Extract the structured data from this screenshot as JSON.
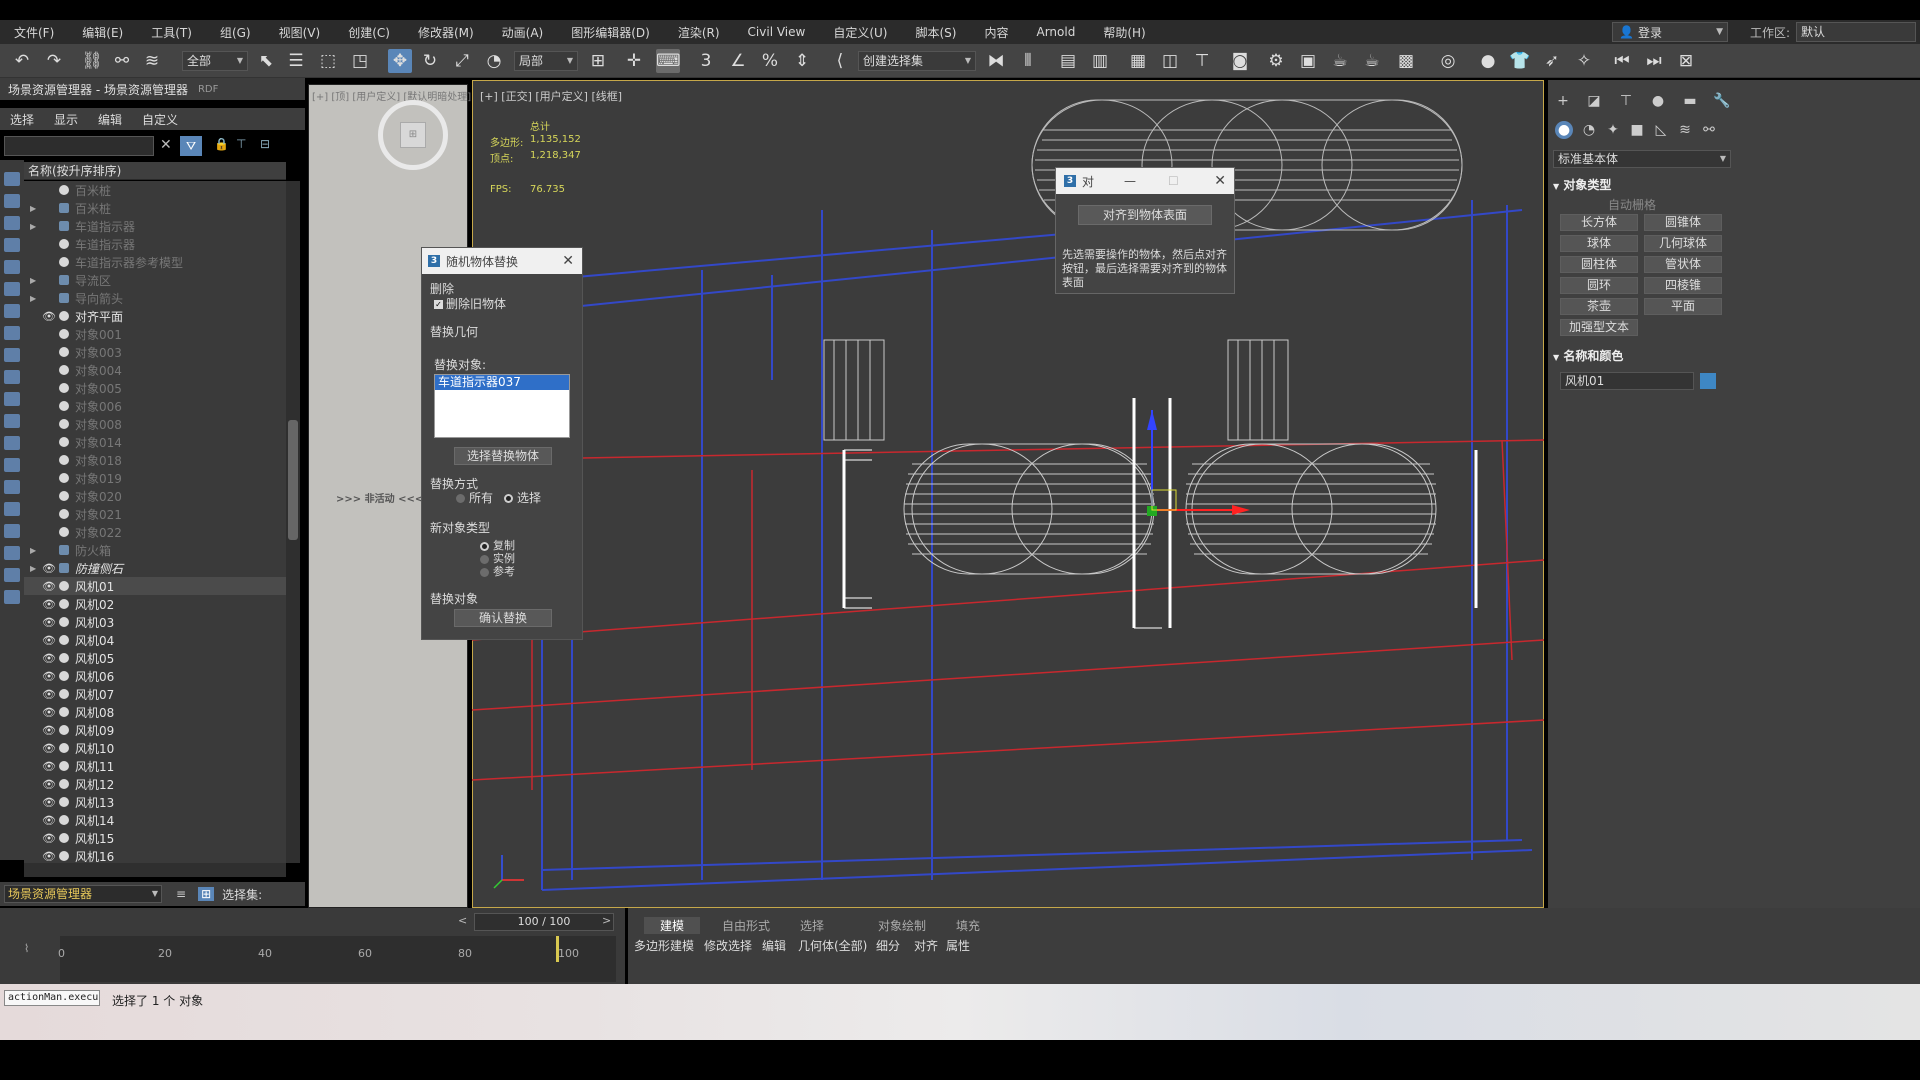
{
  "menu": [
    "文件(F)",
    "编辑(E)",
    "工具(T)",
    "组(G)",
    "视图(V)",
    "创建(C)",
    "修改器(M)",
    "动画(A)",
    "图形编辑器(D)",
    "渲染(R)",
    "Civil View",
    "自定义(U)",
    "脚本(S)",
    "内容",
    "Arnold",
    "帮助(H)"
  ],
  "login": "登录",
  "workspace": {
    "label": "工作区:",
    "value": "默认"
  },
  "toolbar": {
    "filter": "全部",
    "coord": "局部",
    "selset": "创建选择集"
  },
  "scene_explorer": {
    "title": "场景资源管理器 - 场景资源管理器",
    "badge": "RDF",
    "menus": [
      "选择",
      "显示",
      "编辑",
      "自定义"
    ],
    "header": "名称(按升序排序)",
    "items": [
      {
        "label": "百米桩",
        "visible": false,
        "expand": false,
        "group": false
      },
      {
        "label": "百米桩",
        "visible": false,
        "expand": true,
        "group": true
      },
      {
        "label": "车道指示器",
        "visible": false,
        "expand": true,
        "group": true
      },
      {
        "label": "车道指示器",
        "visible": false,
        "expand": false,
        "group": false
      },
      {
        "label": "车道指示器参考模型",
        "visible": false,
        "expand": false,
        "group": false
      },
      {
        "label": "导流区",
        "visible": false,
        "expand": true,
        "group": true
      },
      {
        "label": "导向箭头",
        "visible": false,
        "expand": true,
        "group": true
      },
      {
        "label": "对齐平面",
        "visible": true,
        "expand": false,
        "group": false
      },
      {
        "label": "对象001",
        "visible": false,
        "expand": false,
        "group": false
      },
      {
        "label": "对象003",
        "visible": false,
        "expand": false,
        "group": false
      },
      {
        "label": "对象004",
        "visible": false,
        "expand": false,
        "group": false
      },
      {
        "label": "对象005",
        "visible": false,
        "expand": false,
        "group": false
      },
      {
        "label": "对象006",
        "visible": false,
        "expand": false,
        "group": false
      },
      {
        "label": "对象008",
        "visible": false,
        "expand": false,
        "group": false
      },
      {
        "label": "对象014",
        "visible": false,
        "expand": false,
        "group": false
      },
      {
        "label": "对象018",
        "visible": false,
        "expand": false,
        "group": false
      },
      {
        "label": "对象019",
        "visible": false,
        "expand": false,
        "group": false
      },
      {
        "label": "对象020",
        "visible": false,
        "expand": false,
        "group": false
      },
      {
        "label": "对象021",
        "visible": false,
        "expand": false,
        "group": false
      },
      {
        "label": "对象022",
        "visible": false,
        "expand": false,
        "group": false
      },
      {
        "label": "防火箱",
        "visible": false,
        "expand": true,
        "group": true
      },
      {
        "label": "防撞侧石",
        "visible": true,
        "expand": true,
        "group": true,
        "italic": true
      },
      {
        "label": "风机01",
        "visible": true,
        "expand": false,
        "group": false,
        "selected": true
      },
      {
        "label": "风机02",
        "visible": true,
        "expand": false,
        "group": false
      },
      {
        "label": "风机03",
        "visible": true,
        "expand": false,
        "group": false
      },
      {
        "label": "风机04",
        "visible": true,
        "expand": false,
        "group": false
      },
      {
        "label": "风机05",
        "visible": true,
        "expand": false,
        "group": false
      },
      {
        "label": "风机06",
        "visible": true,
        "expand": false,
        "group": false
      },
      {
        "label": "风机07",
        "visible": true,
        "expand": false,
        "group": false
      },
      {
        "label": "风机08",
        "visible": true,
        "expand": false,
        "group": false
      },
      {
        "label": "风机09",
        "visible": true,
        "expand": false,
        "group": false
      },
      {
        "label": "风机10",
        "visible": true,
        "expand": false,
        "group": false
      },
      {
        "label": "风机11",
        "visible": true,
        "expand": false,
        "group": false
      },
      {
        "label": "风机12",
        "visible": true,
        "expand": false,
        "group": false
      },
      {
        "label": "风机13",
        "visible": true,
        "expand": false,
        "group": false
      },
      {
        "label": "风机14",
        "visible": true,
        "expand": false,
        "group": false
      },
      {
        "label": "风机15",
        "visible": true,
        "expand": false,
        "group": false
      },
      {
        "label": "风机16",
        "visible": true,
        "expand": false,
        "group": false
      }
    ],
    "footer_select": "场景资源管理器",
    "footer_selset": "选择集:"
  },
  "viewport_left": {
    "label": "[+] [顶] [用户定义] [默认明暗处理]",
    "inactive": ">>> 非活动 <<<"
  },
  "viewport_main": {
    "label": "[+] [正交] [用户定义] [线框]",
    "stats": {
      "total_label": "总计",
      "poly_label": "多边形:",
      "poly_value": "1,135,152",
      "vert_label": "顶点:",
      "vert_value": "1,218,347",
      "fps_label": "FPS:",
      "fps_value": "76.735"
    }
  },
  "dialog_replace": {
    "title": "随机物体替换",
    "delete_section": "删除",
    "delete_old": "删除旧物体",
    "geometry_section": "替换几何",
    "target_label": "替换对象:",
    "target_item": "车道指示器037",
    "pick_button": "选择替换物体",
    "mode_section": "替换方式",
    "mode_all": "所有",
    "mode_selected": "选择",
    "newtype_section": "新对象类型",
    "type_copy": "复制",
    "type_instance": "实例",
    "type_reference": "参考",
    "replace_section": "替换对象",
    "confirm_button": "确认替换"
  },
  "dialog_align": {
    "title": "对",
    "button": "对齐到物体表面",
    "description": "先选需要操作的物体，然后点对齐按钮，最后选择需要对齐到的物体表面"
  },
  "command_panel": {
    "dropdown": "标准基本体",
    "object_type_title": "对象类型",
    "autogrid": "自动栅格",
    "objects": [
      "长方体",
      "圆锥体",
      "球体",
      "几何球体",
      "圆柱体",
      "管状体",
      "圆环",
      "四棱锥",
      "茶壶",
      "平面",
      "加强型文本"
    ],
    "name_color_title": "名称和颜色",
    "name_value": "风机01",
    "color": "#3e87c4"
  },
  "timeline": {
    "frame": "100 / 100",
    "ticks": [
      "0",
      "20",
      "40",
      "60",
      "80",
      "100"
    ]
  },
  "ribbon": {
    "tabs": [
      "建模",
      "自由形式",
      "选择",
      "对象绘制",
      "填充"
    ],
    "subtabs": [
      "多边形建模",
      "修改选择",
      "编辑",
      "几何体(全部)",
      "细分",
      "对齐",
      "属性"
    ]
  },
  "status": {
    "maxscript": "actionMan.execu",
    "message": "选择了 1 个 对象"
  }
}
